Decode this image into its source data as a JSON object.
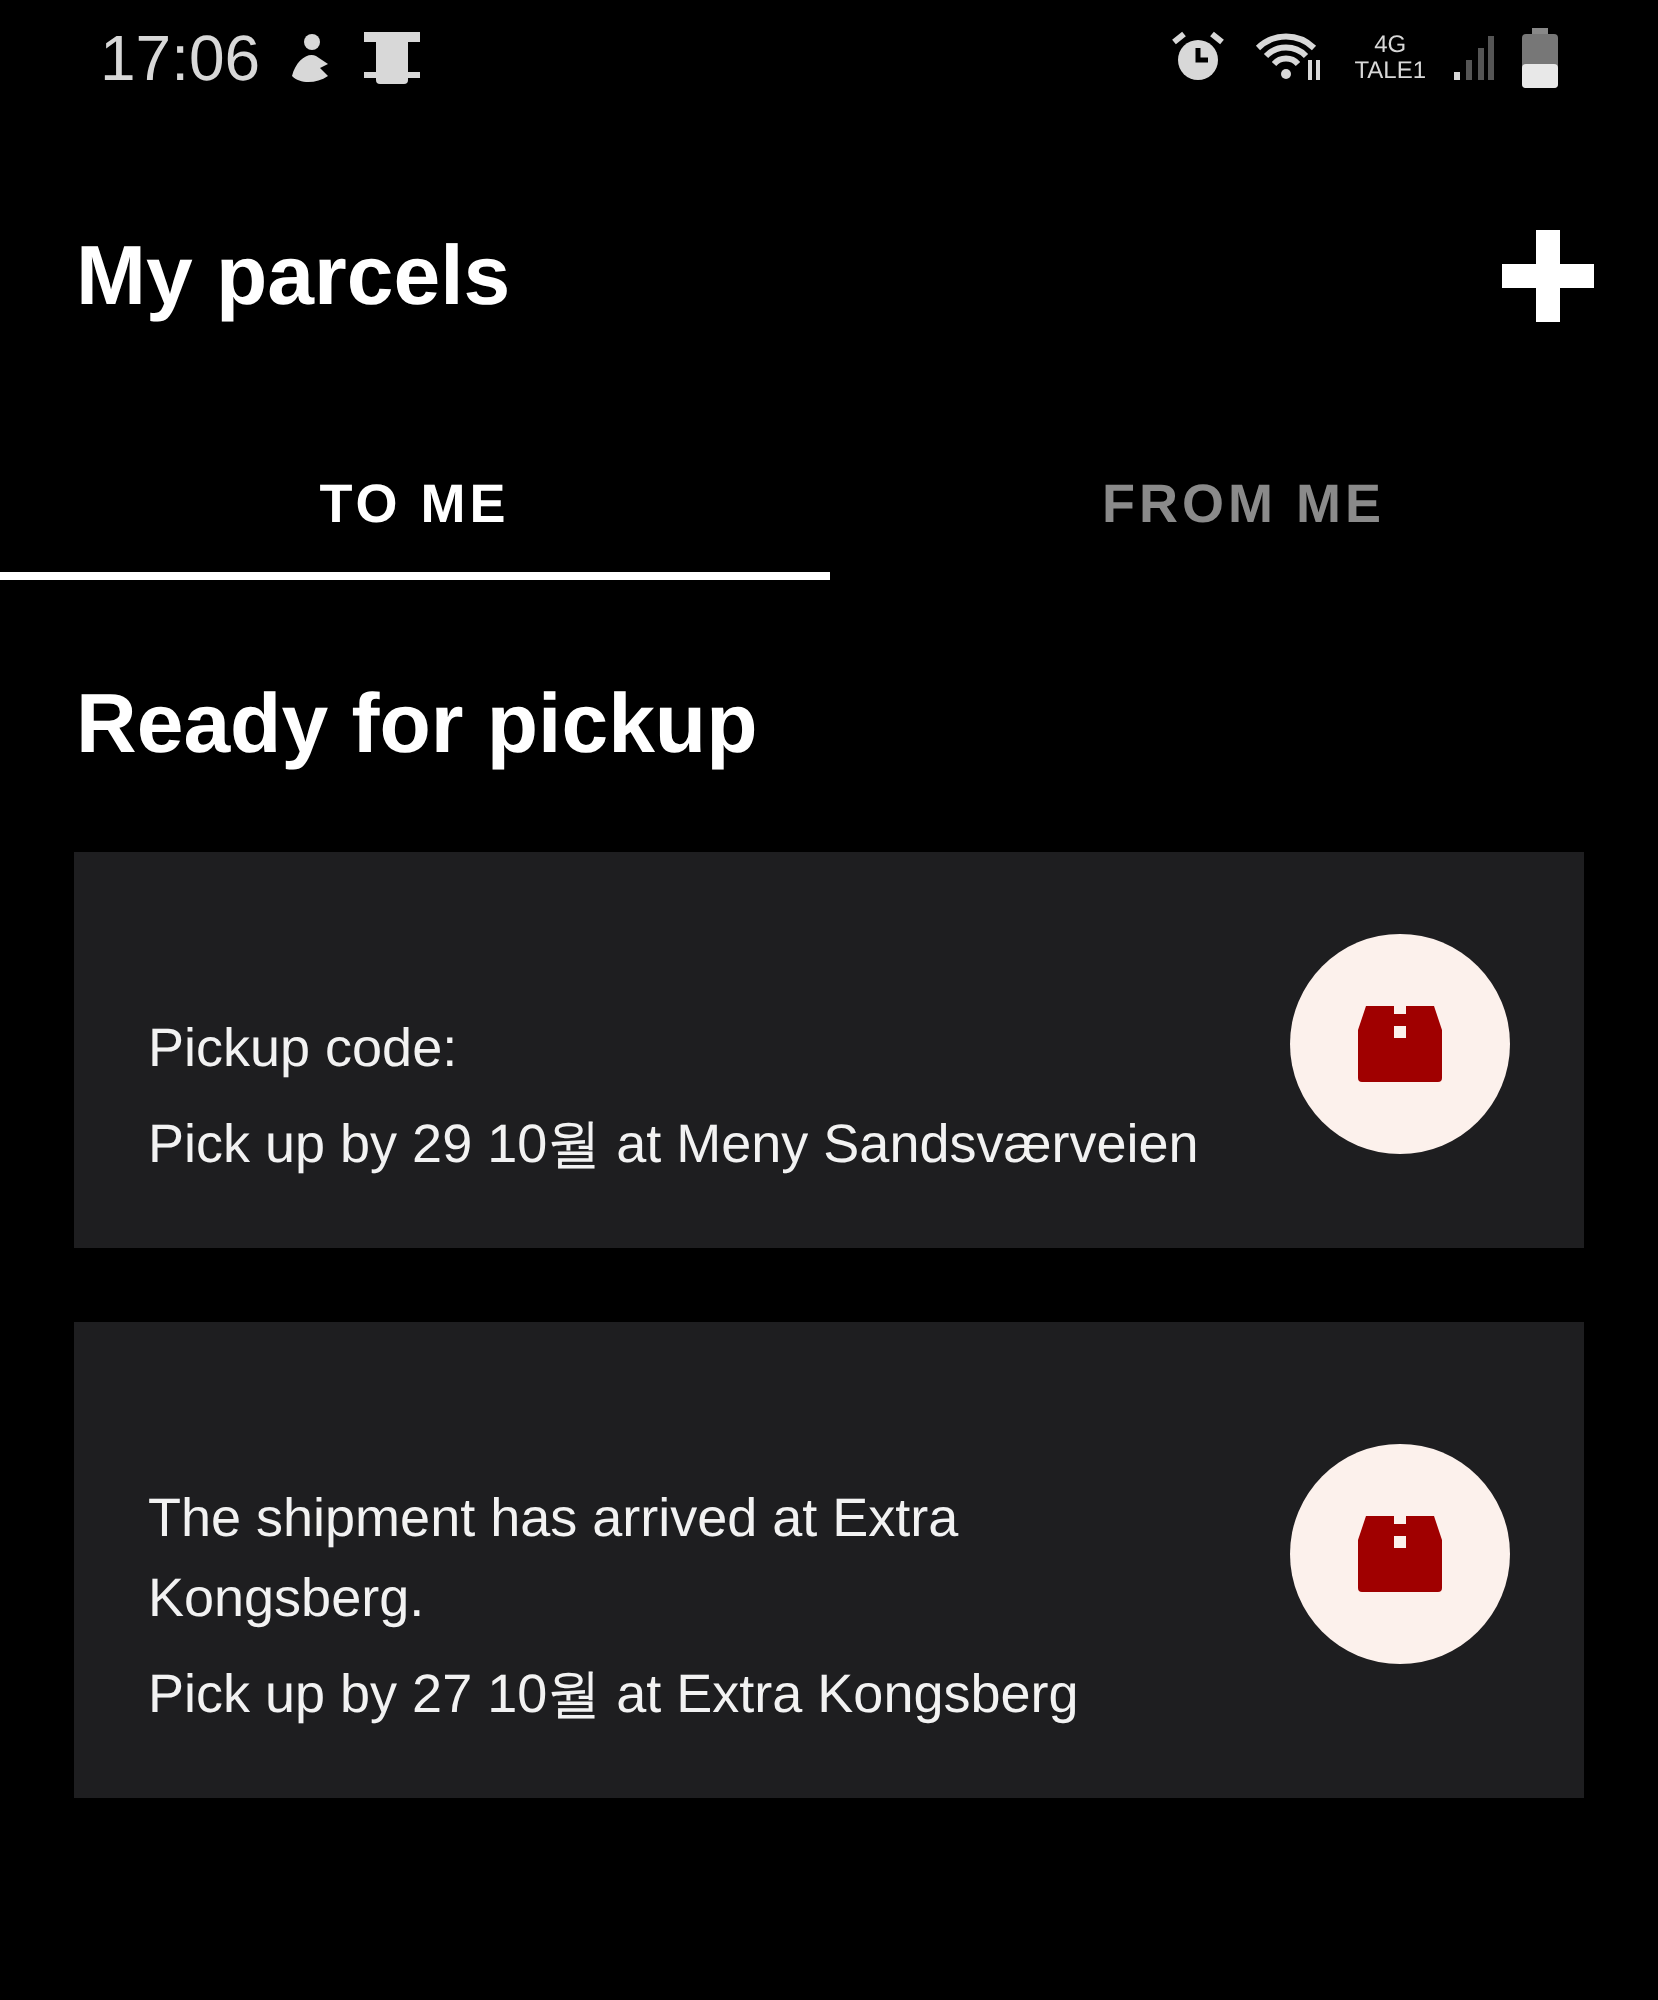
{
  "status_bar": {
    "time": "17:06",
    "network": "4G",
    "carrier": "TALE1"
  },
  "header": {
    "title": "My parcels"
  },
  "tabs": [
    {
      "label": "TO ME",
      "selected": true
    },
    {
      "label": "FROM ME",
      "selected": false
    }
  ],
  "section": {
    "title": "Ready for pickup"
  },
  "parcels": [
    {
      "lines": [
        "Pickup code:"
      ],
      "pickup": "Pick up by 29 10월 at Meny Sandsværveien"
    },
    {
      "lines": [
        "The shipment has arrived at Extra Kongsberg."
      ],
      "pickup": "Pick up by 27 10월 at Extra Kongsberg"
    }
  ]
}
